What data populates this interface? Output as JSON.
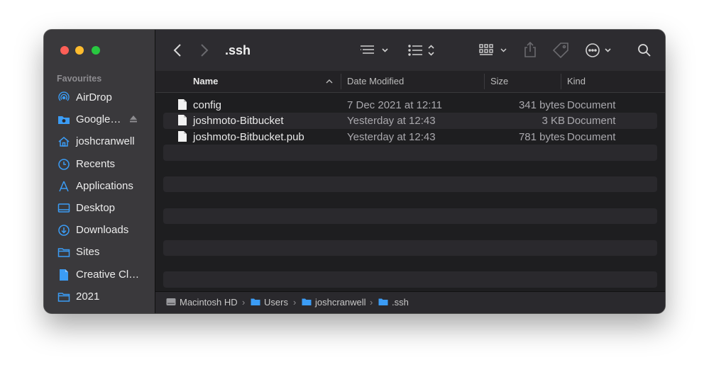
{
  "window": {
    "title": ".ssh"
  },
  "sidebar": {
    "section": "Favourites",
    "items": [
      {
        "label": "AirDrop",
        "icon": "airdrop-icon"
      },
      {
        "label": "Google…",
        "icon": "folder-icon"
      },
      {
        "label": "joshcranwell",
        "icon": "home-icon"
      },
      {
        "label": "Recents",
        "icon": "clock-icon"
      },
      {
        "label": "Applications",
        "icon": "applications-icon"
      },
      {
        "label": "Desktop",
        "icon": "desktop-icon"
      },
      {
        "label": "Downloads",
        "icon": "downloads-icon"
      },
      {
        "label": "Sites",
        "icon": "folder-icon"
      },
      {
        "label": "Creative Cl…",
        "icon": "document-icon"
      },
      {
        "label": "2021",
        "icon": "folder-icon"
      }
    ]
  },
  "columns": {
    "name": "Name",
    "date": "Date Modified",
    "size": "Size",
    "kind": "Kind"
  },
  "files": [
    {
      "name": "config",
      "date": "7 Dec 2021 at 12:11",
      "size": "341 bytes",
      "kind": "Document"
    },
    {
      "name": "joshmoto-Bitbucket",
      "date": "Yesterday at 12:43",
      "size": "3 KB",
      "kind": "Document"
    },
    {
      "name": "joshmoto-Bitbucket.pub",
      "date": "Yesterday at 12:43",
      "size": "781 bytes",
      "kind": "Document"
    }
  ],
  "path": [
    "Macintosh HD",
    "Users",
    "joshcranwell",
    ".ssh"
  ],
  "colors": {
    "accent": "#3b9cf5",
    "close": "#fe5f57",
    "minimize": "#febc2e",
    "zoom": "#28c840"
  }
}
